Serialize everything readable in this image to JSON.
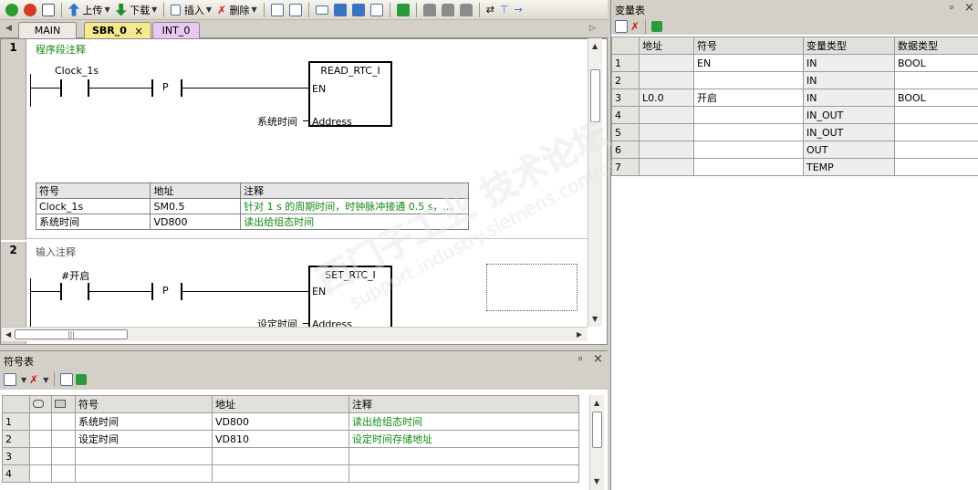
{
  "toolbar": {
    "upload_label": "上传",
    "download_label": "下载",
    "insert_label": "插入",
    "delete_label": "删除"
  },
  "tabs": [
    {
      "label": "MAIN"
    },
    {
      "label": "SBR_0",
      "close": "×"
    },
    {
      "label": "INT_0"
    }
  ],
  "networks": [
    {
      "number": "1",
      "title": "程序段注释",
      "contact_label": "Clock_1s",
      "p_label": "P",
      "block_name": "READ_RTC_I",
      "en_label": "EN",
      "address_pin": "Address",
      "address_operand": "系统时间",
      "symbols": {
        "headers": [
          "符号",
          "地址",
          "注释"
        ],
        "rows": [
          [
            "Clock_1s",
            "SM0.5",
            "针对 1 s 的周期时间，时钟脉冲接通 0.5 s，..."
          ],
          [
            "系统时间",
            "VD800",
            "读出给组态时间"
          ]
        ]
      }
    },
    {
      "number": "2",
      "title": "输入注释",
      "contact_label": "#开启",
      "p_label": "P",
      "block_name": "SET_RTC_I",
      "en_label": "EN",
      "address_pin": "Address",
      "address_operand": "设定时间"
    }
  ],
  "symbol_panel": {
    "title": "符号表",
    "pin": "ᵖ",
    "close": "×",
    "headers": [
      "符号",
      "地址",
      "注释"
    ],
    "rows": [
      {
        "num": "1",
        "symbol": "系统时间",
        "address": "VD800",
        "comment": "读出给组态时间"
      },
      {
        "num": "2",
        "symbol": "设定时间",
        "address": "VD810",
        "comment": "设定时间存储地址"
      },
      {
        "num": "3",
        "symbol": "",
        "address": "",
        "comment": ""
      },
      {
        "num": "4",
        "symbol": "",
        "address": "",
        "comment": ""
      }
    ]
  },
  "var_panel": {
    "title": "变量表",
    "pin": "ᵖ",
    "close": "×",
    "headers": [
      "地址",
      "符号",
      "变量类型",
      "数据类型"
    ],
    "rows": [
      {
        "num": "1",
        "address": "",
        "symbol": "EN",
        "var_type": "IN",
        "data_type": "BOOL"
      },
      {
        "num": "2",
        "address": "",
        "symbol": "",
        "var_type": "IN",
        "data_type": ""
      },
      {
        "num": "3",
        "address": "L0.0",
        "symbol": "开启",
        "var_type": "IN",
        "data_type": "BOOL"
      },
      {
        "num": "4",
        "address": "",
        "symbol": "",
        "var_type": "IN_OUT",
        "data_type": ""
      },
      {
        "num": "5",
        "address": "",
        "symbol": "",
        "var_type": "IN_OUT",
        "data_type": ""
      },
      {
        "num": "6",
        "address": "",
        "symbol": "",
        "var_type": "OUT",
        "data_type": ""
      },
      {
        "num": "7",
        "address": "",
        "symbol": "",
        "var_type": "TEMP",
        "data_type": ""
      }
    ]
  },
  "watermark": {
    "text": "西门子工业 技术论坛",
    "url": "support.industry.siemens.com/cs"
  },
  "colors": {
    "comment_green": "#118a11",
    "sbr_tab": "#f7e98e",
    "int_tab": "#e6c8f2"
  }
}
